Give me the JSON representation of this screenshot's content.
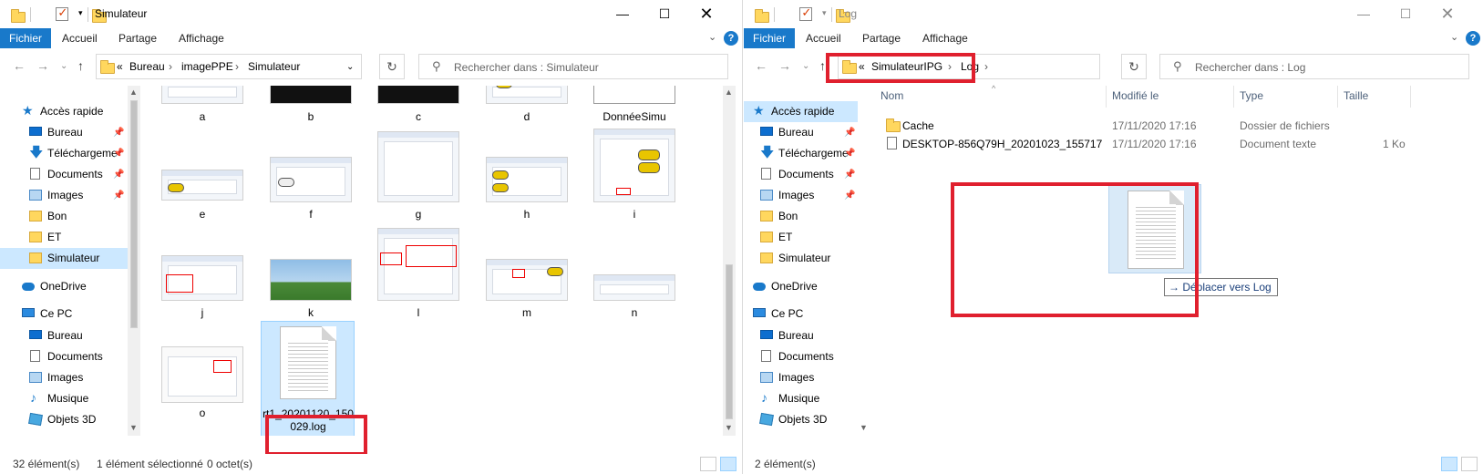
{
  "left": {
    "title": "Simulateur",
    "ribbon_tabs": [
      "Fichier",
      "Accueil",
      "Partage",
      "Affichage"
    ],
    "address": {
      "prefix": "«",
      "parts": [
        "Bureau",
        "imagePPE",
        "Simulateur"
      ]
    },
    "search_placeholder": "Rechercher dans : Simulateur",
    "nav": [
      {
        "label": "Accès rapide",
        "icon": "star-icon"
      },
      {
        "label": "Bureau",
        "icon": "desktop-icon",
        "pinned": true
      },
      {
        "label": "Téléchargeme",
        "icon": "download-icon",
        "pinned": true
      },
      {
        "label": "Documents",
        "icon": "documents-icon",
        "pinned": true
      },
      {
        "label": "Images",
        "icon": "pictures-icon",
        "pinned": true
      },
      {
        "label": "Bon",
        "icon": "folder-icon"
      },
      {
        "label": "ET",
        "icon": "folder-icon"
      },
      {
        "label": "Simulateur",
        "icon": "folder-icon",
        "selected": true
      },
      {
        "label": "OneDrive",
        "icon": "onedrive-icon"
      },
      {
        "label": "Ce PC",
        "icon": "pc-icon"
      },
      {
        "label": "Bureau",
        "icon": "desktop-icon"
      },
      {
        "label": "Documents",
        "icon": "documents-icon"
      },
      {
        "label": "Images",
        "icon": "pictures-icon"
      },
      {
        "label": "Musique",
        "icon": "music-icon"
      },
      {
        "label": "Objets 3D",
        "icon": "3d-objects-icon"
      }
    ],
    "files": [
      "a",
      "b",
      "c",
      "d",
      "DonnéeSimu",
      "e",
      "f",
      "g",
      "h",
      "i",
      "j",
      "k",
      "l",
      "m",
      "n",
      "o"
    ],
    "selected_file": {
      "line1": "rt1_20201120_150",
      "line2": "029.log"
    },
    "status": {
      "count": "32 élément(s)",
      "selection": "1 élément sélectionné",
      "size": "0 octet(s)"
    }
  },
  "right": {
    "title": "Log",
    "ribbon_tabs": [
      "Fichier",
      "Accueil",
      "Partage",
      "Affichage"
    ],
    "address": {
      "prefix": "«",
      "parts": [
        "SimulateurIPG",
        "Log"
      ]
    },
    "search_placeholder": "Rechercher dans : Log",
    "nav": [
      {
        "label": "Accès rapide",
        "icon": "star-icon",
        "selected": true
      },
      {
        "label": "Bureau",
        "icon": "desktop-icon",
        "pinned": true
      },
      {
        "label": "Téléchargeme",
        "icon": "download-icon",
        "pinned": true
      },
      {
        "label": "Documents",
        "icon": "documents-icon",
        "pinned": true
      },
      {
        "label": "Images",
        "icon": "pictures-icon",
        "pinned": true
      },
      {
        "label": "Bon",
        "icon": "folder-icon"
      },
      {
        "label": "ET",
        "icon": "folder-icon"
      },
      {
        "label": "Simulateur",
        "icon": "folder-icon"
      },
      {
        "label": "OneDrive",
        "icon": "onedrive-icon"
      },
      {
        "label": "Ce PC",
        "icon": "pc-icon"
      },
      {
        "label": "Bureau",
        "icon": "desktop-icon"
      },
      {
        "label": "Documents",
        "icon": "documents-icon"
      },
      {
        "label": "Images",
        "icon": "pictures-icon"
      },
      {
        "label": "Musique",
        "icon": "music-icon"
      },
      {
        "label": "Objets 3D",
        "icon": "3d-objects-icon"
      }
    ],
    "columns": [
      "Nom",
      "Modifié le",
      "Type",
      "Taille"
    ],
    "rows": [
      {
        "name": "Cache",
        "date": "17/11/2020 17:16",
        "type": "Dossier de fichiers",
        "size": "",
        "icon": "folder-icon"
      },
      {
        "name": "DESKTOP-856Q79H_20201023_155717",
        "date": "17/11/2020 17:16",
        "type": "Document texte",
        "size": "1 Ko",
        "icon": "text-file-icon"
      }
    ],
    "drag_tip": "Déplacer vers Log",
    "status": {
      "count": "2 élément(s)"
    }
  },
  "colors": {
    "accent": "#1979ca",
    "selection": "#cce8ff",
    "highlight": "#e0202e"
  }
}
